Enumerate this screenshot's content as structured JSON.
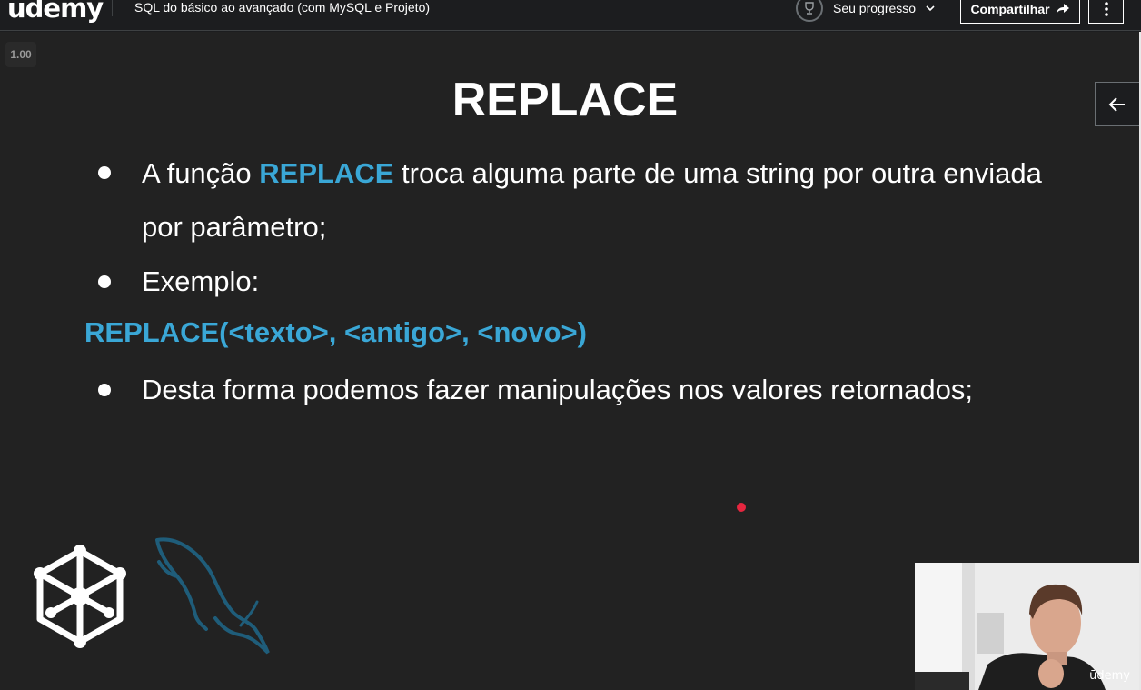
{
  "header": {
    "logo_text": "udemy",
    "course_title": "SQL do básico ao avançado (com MySQL e Projeto)",
    "progress_label": "Seu progresso",
    "share_label": "Compartilhar"
  },
  "player": {
    "speed": "1.00",
    "watermark": "ūdemy"
  },
  "slide": {
    "title": "REPLACE",
    "bullet1_prefix": "A função ",
    "bullet1_highlight": "REPLACE",
    "bullet1_suffix": " troca alguma parte de uma string por outra enviada",
    "bullet1_line2": "por parâmetro;",
    "bullet2": "Exemplo:",
    "code": "REPLACE(<texto>, <antigo>, <novo>)",
    "bullet3": "Desta forma podemos fazer manipulações nos valores retornados;"
  },
  "colors": {
    "background": "#1c1d1f",
    "slide_bg": "#222222",
    "accent": "#3aa7d6",
    "pointer": "#e6263f"
  },
  "icons": [
    "trophy-icon",
    "chevron-down-icon",
    "share-arrow-icon",
    "kebab-icon",
    "arrow-left-icon",
    "cube-network-logo",
    "mysql-dolphin-logo"
  ]
}
